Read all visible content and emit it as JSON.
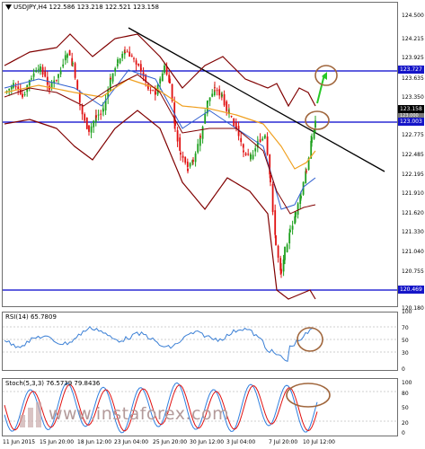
{
  "chart": {
    "symbol_info": "USDJPY,H4  122.586 123.218 122.521 123.158",
    "colors": {
      "bull": "#1ea01e",
      "bear": "#e01010",
      "bands": "#800000",
      "ma_blue": "#2f5fcf",
      "ma_orange": "#f0a020",
      "levels": "#0000cc",
      "trendline": "#000000",
      "circles": "#a0663c",
      "rsi": "#3a7fd5",
      "stoch_main": "#2f7fdf",
      "stoch_signal": "#e01010",
      "green_arrow": "#28c828"
    },
    "price_axis": [
      "124.500",
      "124.215",
      "123.925",
      "123.635",
      "123.350",
      "123.065",
      "122.775",
      "122.485",
      "122.195",
      "121.910",
      "121.620",
      "121.330",
      "121.040",
      "120.755",
      "120.465"
    ],
    "price_flags": {
      "upper_level": "123.727",
      "current_price": "123.158",
      "current_price_2": "123.000",
      "middle_level": "123.003",
      "lower_level": "120.469"
    },
    "lowest_label": "120.180"
  },
  "rsi": {
    "title": "RSI(14) 65.7809",
    "axis": [
      "100",
      "70",
      "50",
      "30",
      "0"
    ]
  },
  "stochastic": {
    "title": "Stoch(5,3,3) 76.5739 79.8436",
    "axis": [
      "100",
      "80",
      "50",
      "20",
      "0"
    ]
  },
  "dates": [
    "11 Jun 2015",
    "15 Jun 20:00",
    "18 Jun 12:00",
    "23 Jun 04:00",
    "25 Jun 20:00",
    "30 Jun 12:00",
    "3 Jul 04:00",
    "7 Jul 20:00",
    "10 Jul 12:00"
  ],
  "watermark": "www.instaforex.com"
}
